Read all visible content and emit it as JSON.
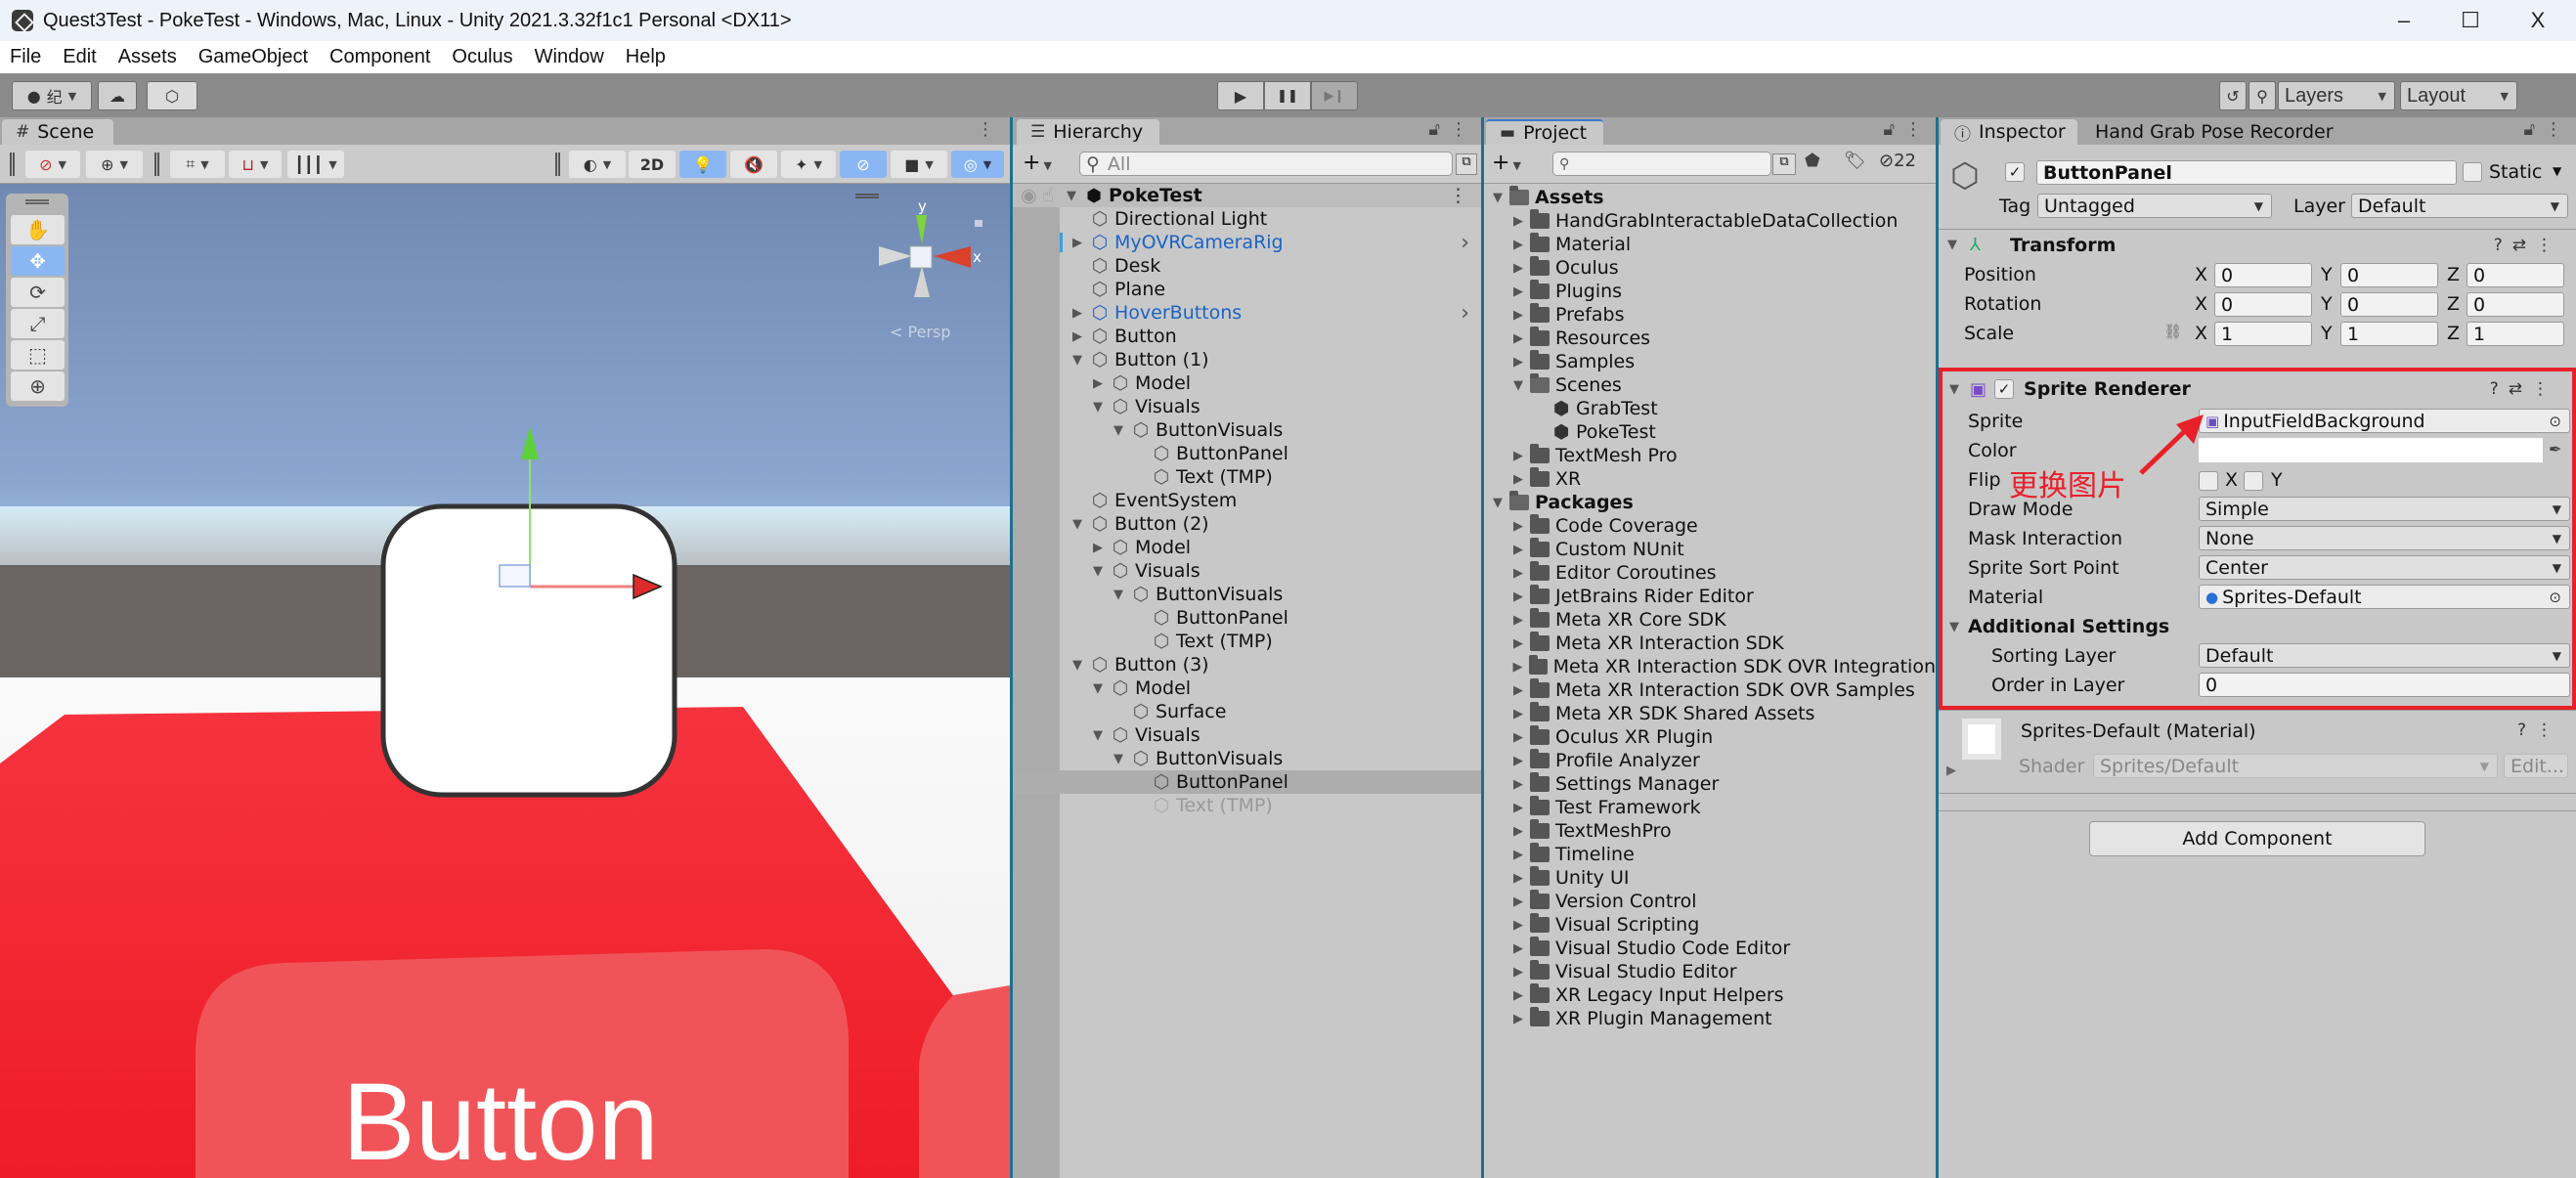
{
  "window": {
    "title": "Quest3Test - PokeTest - Windows, Mac, Linux - Unity 2021.3.32f1c1 Personal <DX11>",
    "controls": {
      "minimize": "–",
      "maximize": "☐",
      "close": "X"
    }
  },
  "menu": [
    "File",
    "Edit",
    "Assets",
    "GameObject",
    "Component",
    "Oculus",
    "Window",
    "Help"
  ],
  "toolbar": {
    "account_label": "纪",
    "play_icon": "▶",
    "pause_icon": "❚❚",
    "step_icon": "▶❙",
    "layers_label": "Layers",
    "layout_label": "Layout"
  },
  "scene": {
    "tab_label": "Scene",
    "tab_icon": "#",
    "mode_2d_label": "2D",
    "gizmo": {
      "y_label": "y",
      "x_label": "x",
      "projection_label": "< Persp"
    },
    "button_text": "Button",
    "tools": [
      "hand-tool",
      "move-tool",
      "rotate-tool",
      "scale-tool",
      "rect-tool",
      "transform-tool"
    ]
  },
  "hierarchy": {
    "tab_label": "Hierarchy",
    "search_placeholder": "All",
    "scene_name": "PokeTest",
    "items": [
      {
        "label": "Directional Light",
        "depth": 1,
        "expander": "none",
        "prefab": false
      },
      {
        "label": "MyOVRCameraRig",
        "depth": 1,
        "expander": "collapsed",
        "prefab": true
      },
      {
        "label": "Desk",
        "depth": 1,
        "expander": "none",
        "prefab": false
      },
      {
        "label": "Plane",
        "depth": 1,
        "expander": "none",
        "prefab": false
      },
      {
        "label": "HoverButtons",
        "depth": 1,
        "expander": "collapsed",
        "prefab": true
      },
      {
        "label": "Button",
        "depth": 1,
        "expander": "collapsed",
        "prefab": false
      },
      {
        "label": "Button (1)",
        "depth": 1,
        "expander": "expanded",
        "prefab": false
      },
      {
        "label": "Model",
        "depth": 2,
        "expander": "collapsed",
        "prefab": false
      },
      {
        "label": "Visuals",
        "depth": 2,
        "expander": "expanded",
        "prefab": false
      },
      {
        "label": "ButtonVisuals",
        "depth": 3,
        "expander": "expanded",
        "prefab": false
      },
      {
        "label": "ButtonPanel",
        "depth": 4,
        "expander": "none",
        "prefab": false
      },
      {
        "label": "Text (TMP)",
        "depth": 4,
        "expander": "none",
        "prefab": false
      },
      {
        "label": "EventSystem",
        "depth": 1,
        "expander": "none",
        "prefab": false
      },
      {
        "label": "Button (2)",
        "depth": 1,
        "expander": "expanded",
        "prefab": false
      },
      {
        "label": "Model",
        "depth": 2,
        "expander": "collapsed",
        "prefab": false
      },
      {
        "label": "Visuals",
        "depth": 2,
        "expander": "expanded",
        "prefab": false
      },
      {
        "label": "ButtonVisuals",
        "depth": 3,
        "expander": "expanded",
        "prefab": false
      },
      {
        "label": "ButtonPanel",
        "depth": 4,
        "expander": "none",
        "prefab": false
      },
      {
        "label": "Text (TMP)",
        "depth": 4,
        "expander": "none",
        "prefab": false
      },
      {
        "label": "Button (3)",
        "depth": 1,
        "expander": "expanded",
        "prefab": false
      },
      {
        "label": "Model",
        "depth": 2,
        "expander": "expanded",
        "prefab": false
      },
      {
        "label": "Surface",
        "depth": 3,
        "expander": "none",
        "prefab": false
      },
      {
        "label": "Visuals",
        "depth": 2,
        "expander": "expanded",
        "prefab": false
      },
      {
        "label": "ButtonVisuals",
        "depth": 3,
        "expander": "expanded",
        "prefab": false
      },
      {
        "label": "ButtonPanel",
        "depth": 4,
        "expander": "none",
        "prefab": false,
        "selected": true
      },
      {
        "label": "Text (TMP)",
        "depth": 4,
        "expander": "none",
        "prefab": false,
        "disabled": true
      }
    ]
  },
  "project": {
    "tab_label": "Project",
    "search_placeholder": "",
    "hidden_count": "22",
    "items": [
      {
        "label": "Assets",
        "depth": 0,
        "expander": "expanded",
        "type": "folder-open",
        "bold": true
      },
      {
        "label": "HandGrabInteractableDataCollection",
        "depth": 1,
        "expander": "collapsed",
        "type": "folder"
      },
      {
        "label": "Material",
        "depth": 1,
        "expander": "collapsed",
        "type": "folder"
      },
      {
        "label": "Oculus",
        "depth": 1,
        "expander": "collapsed",
        "type": "folder"
      },
      {
        "label": "Plugins",
        "depth": 1,
        "expander": "collapsed",
        "type": "folder"
      },
      {
        "label": "Prefabs",
        "depth": 1,
        "expander": "collapsed",
        "type": "folder"
      },
      {
        "label": "Resources",
        "depth": 1,
        "expander": "collapsed",
        "type": "folder"
      },
      {
        "label": "Samples",
        "depth": 1,
        "expander": "collapsed",
        "type": "folder"
      },
      {
        "label": "Scenes",
        "depth": 1,
        "expander": "expanded",
        "type": "folder-open"
      },
      {
        "label": "GrabTest",
        "depth": 2,
        "expander": "none",
        "type": "scene"
      },
      {
        "label": "PokeTest",
        "depth": 2,
        "expander": "none",
        "type": "scene"
      },
      {
        "label": "TextMesh Pro",
        "depth": 1,
        "expander": "collapsed",
        "type": "folder"
      },
      {
        "label": "XR",
        "depth": 1,
        "expander": "collapsed",
        "type": "folder"
      },
      {
        "label": "Packages",
        "depth": 0,
        "expander": "expanded",
        "type": "folder-open",
        "bold": true
      },
      {
        "label": "Code Coverage",
        "depth": 1,
        "expander": "collapsed",
        "type": "folder"
      },
      {
        "label": "Custom NUnit",
        "depth": 1,
        "expander": "collapsed",
        "type": "folder"
      },
      {
        "label": "Editor Coroutines",
        "depth": 1,
        "expander": "collapsed",
        "type": "folder"
      },
      {
        "label": "JetBrains Rider Editor",
        "depth": 1,
        "expander": "collapsed",
        "type": "folder"
      },
      {
        "label": "Meta XR Core SDK",
        "depth": 1,
        "expander": "collapsed",
        "type": "folder"
      },
      {
        "label": "Meta XR Interaction SDK",
        "depth": 1,
        "expander": "collapsed",
        "type": "folder"
      },
      {
        "label": "Meta XR Interaction SDK OVR Integration",
        "depth": 1,
        "expander": "collapsed",
        "type": "folder"
      },
      {
        "label": "Meta XR Interaction SDK OVR Samples",
        "depth": 1,
        "expander": "collapsed",
        "type": "folder"
      },
      {
        "label": "Meta XR SDK Shared Assets",
        "depth": 1,
        "expander": "collapsed",
        "type": "folder"
      },
      {
        "label": "Oculus XR Plugin",
        "depth": 1,
        "expander": "collapsed",
        "type": "folder"
      },
      {
        "label": "Profile Analyzer",
        "depth": 1,
        "expander": "collapsed",
        "type": "folder"
      },
      {
        "label": "Settings Manager",
        "depth": 1,
        "expander": "collapsed",
        "type": "folder"
      },
      {
        "label": "Test Framework",
        "depth": 1,
        "expander": "collapsed",
        "type": "folder"
      },
      {
        "label": "TextMeshPro",
        "depth": 1,
        "expander": "collapsed",
        "type": "folder"
      },
      {
        "label": "Timeline",
        "depth": 1,
        "expander": "collapsed",
        "type": "folder"
      },
      {
        "label": "Unity UI",
        "depth": 1,
        "expander": "collapsed",
        "type": "folder"
      },
      {
        "label": "Version Control",
        "depth": 1,
        "expander": "collapsed",
        "type": "folder"
      },
      {
        "label": "Visual Scripting",
        "depth": 1,
        "expander": "collapsed",
        "type": "folder"
      },
      {
        "label": "Visual Studio Code Editor",
        "depth": 1,
        "expander": "collapsed",
        "type": "folder"
      },
      {
        "label": "Visual Studio Editor",
        "depth": 1,
        "expander": "collapsed",
        "type": "folder"
      },
      {
        "label": "XR Legacy Input Helpers",
        "depth": 1,
        "expander": "collapsed",
        "type": "folder"
      },
      {
        "label": "XR Plugin Management",
        "depth": 1,
        "expander": "collapsed",
        "type": "folder"
      }
    ]
  },
  "inspector": {
    "tab_label": "Inspector",
    "second_tab_label": "Hand Grab Pose Recorder",
    "object_name": "ButtonPanel",
    "active": true,
    "static_label": "Static",
    "static_checked": false,
    "tag_label": "Tag",
    "tag_value": "Untagged",
    "layer_label": "Layer",
    "layer_value": "Default",
    "transform": {
      "title": "Transform",
      "rows": [
        {
          "label": "Position",
          "x": "0",
          "y": "0",
          "z": "0"
        },
        {
          "label": "Rotation",
          "x": "0",
          "y": "0",
          "z": "0"
        },
        {
          "label": "Scale",
          "x": "1",
          "y": "1",
          "z": "1"
        }
      ],
      "axis_labels": {
        "x": "X",
        "y": "Y",
        "z": "Z"
      }
    },
    "sprite_renderer": {
      "title": "Sprite Renderer",
      "enabled": true,
      "sprite_label": "Sprite",
      "sprite_value": "InputFieldBackground",
      "color_label": "Color",
      "color_value": "#ffffff",
      "flip_label": "Flip",
      "flip_x_label": "X",
      "flip_y_label": "Y",
      "draw_mode_label": "Draw Mode",
      "draw_mode_value": "Simple",
      "mask_label": "Mask Interaction",
      "mask_value": "None",
      "sort_point_label": "Sprite Sort Point",
      "sort_point_value": "Center",
      "material_label": "Material",
      "material_value": "Sprites-Default",
      "additional_label": "Additional Settings",
      "sorting_layer_label": "Sorting Layer",
      "sorting_layer_value": "Default",
      "order_label": "Order in Layer",
      "order_value": "0"
    },
    "material": {
      "title": "Sprites-Default (Material)",
      "shader_label": "Shader",
      "shader_value": "Sprites/Default",
      "edit_label": "Edit..."
    },
    "add_component_label": "Add Component"
  },
  "annotation": {
    "text": "更换图片",
    "color": "#e8202a"
  },
  "colors": {
    "accent_blue": "#8ab7f3",
    "prefab_blue": "#1a63c4",
    "highlight_red": "#e8202a",
    "button_red": "#f0242f"
  }
}
